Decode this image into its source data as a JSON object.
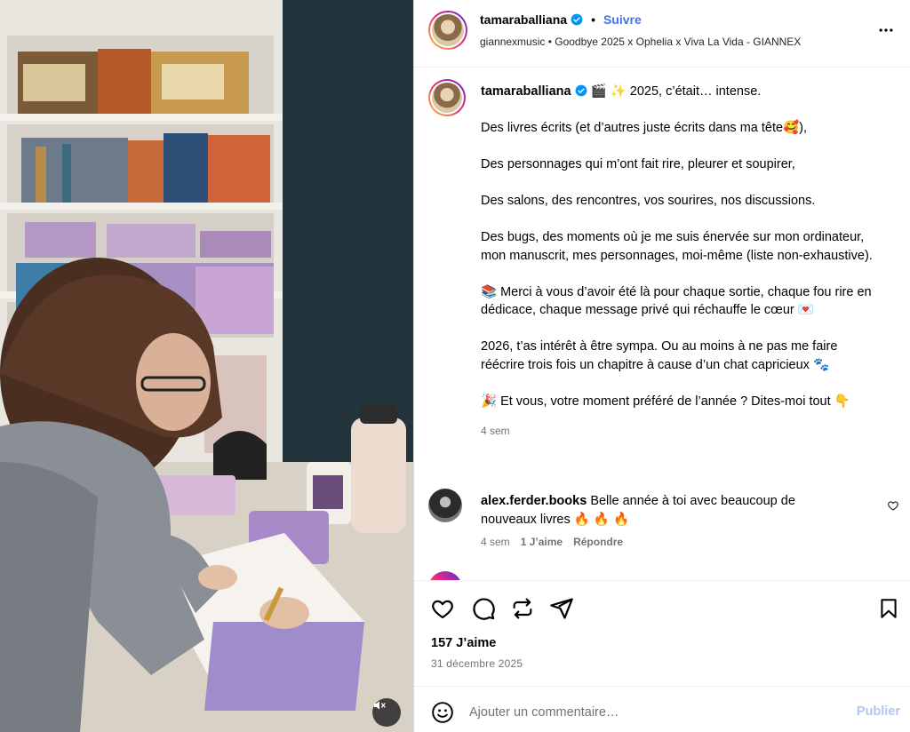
{
  "media": {
    "mute_icon": "volume-muted-icon"
  },
  "header": {
    "username": "tamaraballiana",
    "follow_label": "Suivre",
    "separator": "•",
    "audio": "giannexmusic • Goodbye 2025 x Ophelia x Viva La Vida - GIANNEX",
    "more_icon": "more-horizontal-icon"
  },
  "caption": {
    "username": "tamaraballiana",
    "lines": [
      "🎬 ✨ 2025, c’était… intense.",
      "Des livres écrits (et d’autres juste écrits dans ma tête🥰),",
      "Des personnages qui m’ont fait rire, pleurer et soupirer,",
      "Des salons, des rencontres, vos sourires, nos discussions.",
      "Des bugs, des moments où je me suis énervée sur mon ordinateur, mon manuscrit, mes personnages, moi-même (liste non-exhaustive).",
      "📚 Merci à vous d’avoir été là pour chaque sortie, chaque fou rire en dédicace, chaque message privé qui réchauffe le cœur 💌",
      "2026, t’as intérêt à être sympa. Ou au moins à ne pas me faire réécrire trois fois un chapitre à cause d’un chat capricieux 🐾",
      "🎉 Et vous, votre moment préféré de l’année ? Dites-moi tout 👇"
    ],
    "time": "4 sem"
  },
  "comments": [
    {
      "username": "alex.ferder.books",
      "text": "Belle année à toi avec beaucoup de nouveaux livres 🔥 🔥 🔥",
      "time": "4 sem",
      "likes": "1 J’aime",
      "reply_label": "Répondre"
    }
  ],
  "actions": {
    "icons": [
      "heart-icon",
      "comment-icon",
      "repost-icon",
      "share-icon",
      "bookmark-icon"
    ]
  },
  "likes_text": "157 J’aime",
  "date_text": "31 décembre 2025",
  "add_comment": {
    "placeholder": "Ajouter un commentaire…",
    "publish_label": "Publier"
  },
  "colors": {
    "accent": "#4c6fe6",
    "publish_disabled": "#b3c4f5",
    "verified": "#0095f6"
  }
}
